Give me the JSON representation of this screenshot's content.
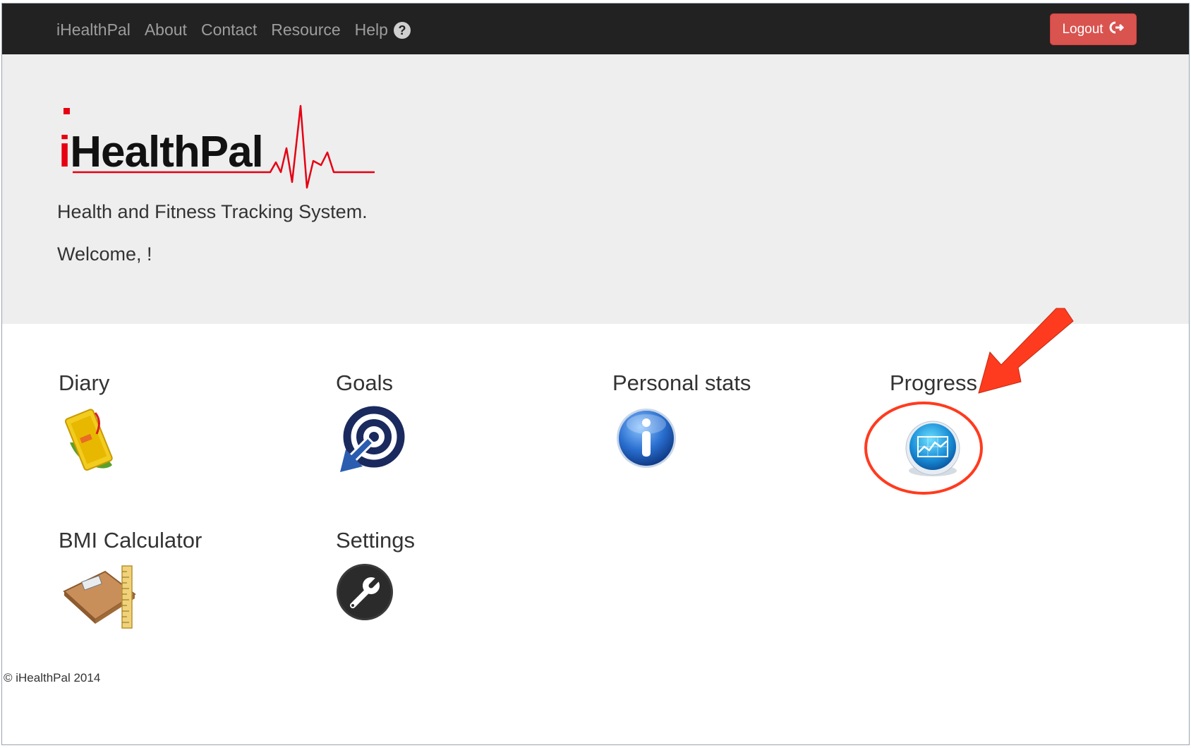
{
  "navbar": {
    "links": [
      "iHealthPal",
      "About",
      "Contact",
      "Resource"
    ],
    "help_label": "Help",
    "help_icon": "question-circle-icon",
    "logout_label": "Logout",
    "logout_icon": "sign-out-icon",
    "background": "#222222",
    "logout_color": "#d9534f"
  },
  "hero": {
    "logo_text_i": "i",
    "logo_text_rest": "HealthPal",
    "tagline": "Health and Fitness Tracking System.",
    "welcome": "Welcome, !",
    "background": "#eeeeee"
  },
  "tiles": {
    "diary": {
      "label": "Diary",
      "icon": "diary-notebook-icon"
    },
    "goals": {
      "label": "Goals",
      "icon": "target-arrow-icon"
    },
    "personal_stats": {
      "label": "Personal stats",
      "icon": "info-icon"
    },
    "progress": {
      "label": "Progress",
      "icon": "chart-icon"
    },
    "bmi": {
      "label": "BMI Calculator",
      "icon": "scale-ruler-icon"
    },
    "settings": {
      "label": "Settings",
      "icon": "wrench-icon"
    }
  },
  "footer": {
    "copyright": "© iHealthPal 2014"
  },
  "annotation": {
    "color": "#ff3b1f",
    "shapes": [
      "highlight-circle",
      "pointer-arrow"
    ]
  }
}
